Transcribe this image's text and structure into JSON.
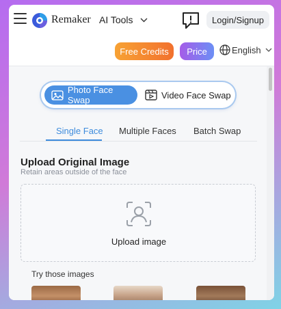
{
  "header": {
    "brand": "Remaker",
    "nav_ai_tools": "AI Tools",
    "login_label": "Login/Signup"
  },
  "actions": {
    "free_credits": "Free Credits",
    "price": "Price",
    "language": "English"
  },
  "mode_switch": {
    "photo_label": "Photo Face Swap",
    "video_label": "Video Face Swap",
    "active": "photo"
  },
  "tabs": [
    {
      "label": "Single Face",
      "active": true
    },
    {
      "label": "Multiple Faces",
      "active": false
    },
    {
      "label": "Batch Swap",
      "active": false
    }
  ],
  "upload": {
    "title": "Upload Original Image",
    "subtitle": "Retain areas outside of the face",
    "button_label": "Upload image"
  },
  "samples": {
    "label": "Try those images",
    "count": 3
  },
  "colors": {
    "accent": "#3d8bdc",
    "photo_button": "#4a90e2",
    "credits_gradient_start": "#f7a234",
    "credits_gradient_end": "#f2712e",
    "price_gradient_start": "#a55ce8",
    "price_gradient_end": "#6c8ff5"
  },
  "icons": {
    "menu": "hamburger-menu-icon",
    "logo": "remaker-logo-icon",
    "dropdown": "chevron-down-icon",
    "feedback": "feedback-alert-icon",
    "language": "globe-icon",
    "photo": "image-icon",
    "video": "film-icon",
    "upload": "face-scan-icon"
  }
}
